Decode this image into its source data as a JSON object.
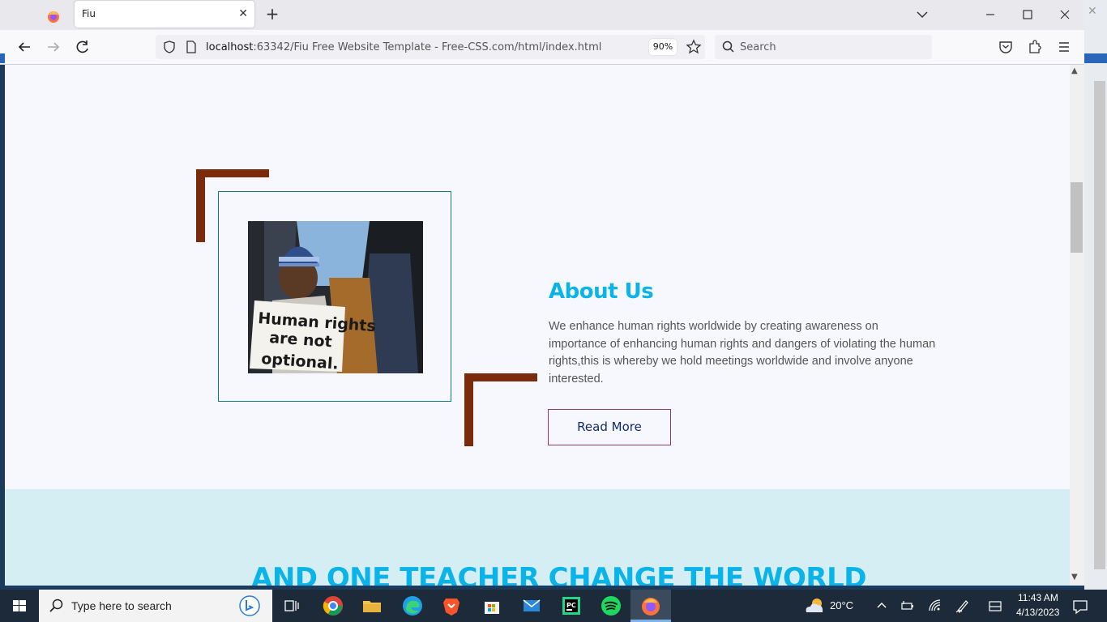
{
  "browser": {
    "tab_title": "Fiu",
    "tab_close": "✕",
    "new_tab": "+",
    "url_host": "localhost",
    "url_rest": ":63342/Fiu Free Website Template - Free-CSS.com/html/index.html",
    "zoom": "90%",
    "search_placeholder": "Search"
  },
  "page": {
    "about": {
      "title": "About Us",
      "text": "We enhance human rights worldwide by creating awareness on importance of enhancing human rights and dangers of violating the human rights,this is whereby we hold meetings worldwide and involve anyone interested.",
      "button": "Read More",
      "photo_sign_lines": [
        "Human rights",
        "are not",
        "optional."
      ]
    },
    "teacher": {
      "title": "AND ONE TEACHER CHANGE THE WORLD"
    }
  },
  "taskbar": {
    "search_placeholder": "Type here to search",
    "weather": "20°C",
    "time": "11:43 AM",
    "date": "4/13/2023"
  },
  "colors": {
    "accent": "#0ab3e8",
    "bracket": "#7b2a0b",
    "frame": "#167a7a",
    "button_border": "#8b3a6a",
    "button_text": "#102a6b"
  }
}
